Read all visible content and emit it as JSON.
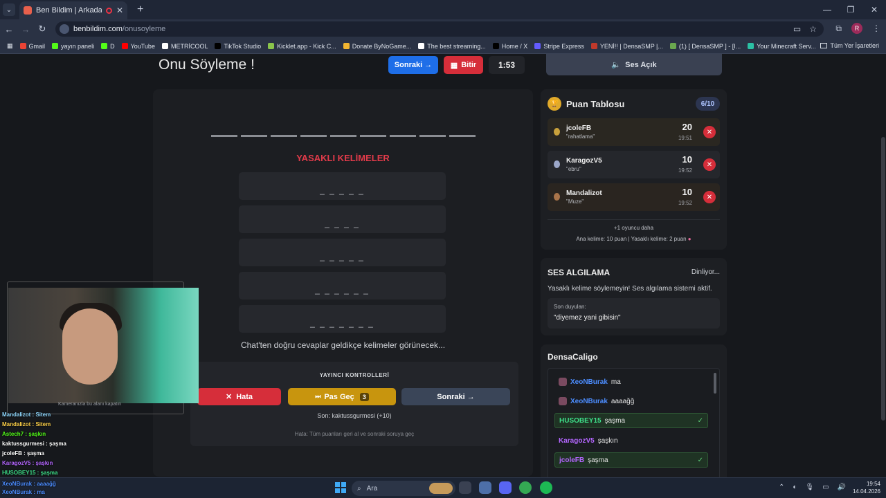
{
  "browser": {
    "tab_title": "Ben Bildim | Arkadaşlarınla",
    "host": "benbildim.com",
    "path": "/onusoyleme",
    "bookmarks": [
      "Gmail",
      "yayın paneli",
      "D",
      "YouTube",
      "METRİCOOL",
      "TikTok Studio",
      "Kicklet.app - Kick C...",
      "Donate ByNoGame...",
      "The best streaming...",
      "Home / X",
      "Stripe Express",
      "YENİ!! | DensaSMP |...",
      "(1) [ DensaSMP ] - [I...",
      "Your Minecraft Serv..."
    ],
    "all_bookmarks": "Tüm Yer İşaretleri",
    "avatar_letter": "R"
  },
  "game": {
    "title": "Onu Söyleme !",
    "next_top": "Sonraki →",
    "finish": "Bitir",
    "timer": "1:53",
    "forbidden_title": "YASAKLI KELİMELER",
    "forbidden_words": [
      "_ _ _ _ _",
      "_ _ _ _",
      "_ _ _ _ _",
      "_ _ _ _ _ _",
      "_ _ _ _ _ _ _"
    ],
    "chat_hint": "Chat'ten doğru cevaplar geldikçe kelimeler görünecek...",
    "controls_title": "YAYINCI KONTROLLERİ",
    "error_btn": "Hata",
    "pass_btn": "Pas Geç",
    "pass_count": "3",
    "next_btn": "Sonraki →",
    "last": "Son: kaktussgurmesi (+10)",
    "hint": "Hata: Tüm puanları geri al ve sonraki soruya geç"
  },
  "sound": {
    "label": "Ses Açık"
  },
  "scoreboard": {
    "title": "Puan Tablosu",
    "round": "6/10",
    "players": [
      {
        "name": "jcoleFB",
        "word": "\"rahatlama\"",
        "score": "20",
        "time": "19:51"
      },
      {
        "name": "KaragozV5",
        "word": "\"ebru\"",
        "score": "10",
        "time": "19:52"
      },
      {
        "name": "Mandalizot",
        "word": "\"Muze\"",
        "score": "10",
        "time": "19:52"
      }
    ],
    "more": "+1 oyuncu daha",
    "rule": "Ana kelime: 10 puan | Yasaklı kelime: 2 puan"
  },
  "voice": {
    "title": "SES ALGILAMA",
    "status": "Dinliyor...",
    "desc": "Yasaklı kelime söylemeyin! Ses algılama sistemi aktif.",
    "heard_label": "Son duyulan:",
    "heard_text": "\"diyemez yani gibisin\""
  },
  "chat": {
    "title": "DensaCaligo",
    "messages": [
      {
        "user": "XeoNBurak",
        "text": "ma",
        "ok": false,
        "color": "#4c8dff"
      },
      {
        "user": "XeoNBurak",
        "text": "aaaağğ",
        "ok": false,
        "color": "#4c8dff"
      },
      {
        "user": "HUSOBEY15",
        "text": "şaşma",
        "ok": true,
        "color": "#3ee08a"
      },
      {
        "user": "KaragozV5",
        "text": "şaşkın",
        "ok": false,
        "color": "#b466ff"
      },
      {
        "user": "jcoleFB",
        "text": "şaşma",
        "ok": true,
        "color": "#b466ff"
      }
    ]
  },
  "overlay_chat": [
    "Mandalizot : Sitem",
    "Mandalizot : Sitem",
    "Astech7 : şaşkın",
    "kaktussgurmesi : şaşma",
    "jcoleFB : şaşma",
    "KaragozV5 : şaşkın",
    "HUSOBEY15 : şaşma",
    "XeoNBurak : aaaağğ",
    "XeoNBurak : ma"
  ],
  "cam_note": "Kameranızla bu alanı kapatın",
  "taskbar": {
    "search": "Ara",
    "time": "19:54",
    "date": "14.04.2026"
  },
  "colors": {
    "danger": "#d62e3a",
    "primary": "#1e6ee8",
    "warn": "#c8950e",
    "accent_red": "#e23b4a"
  }
}
